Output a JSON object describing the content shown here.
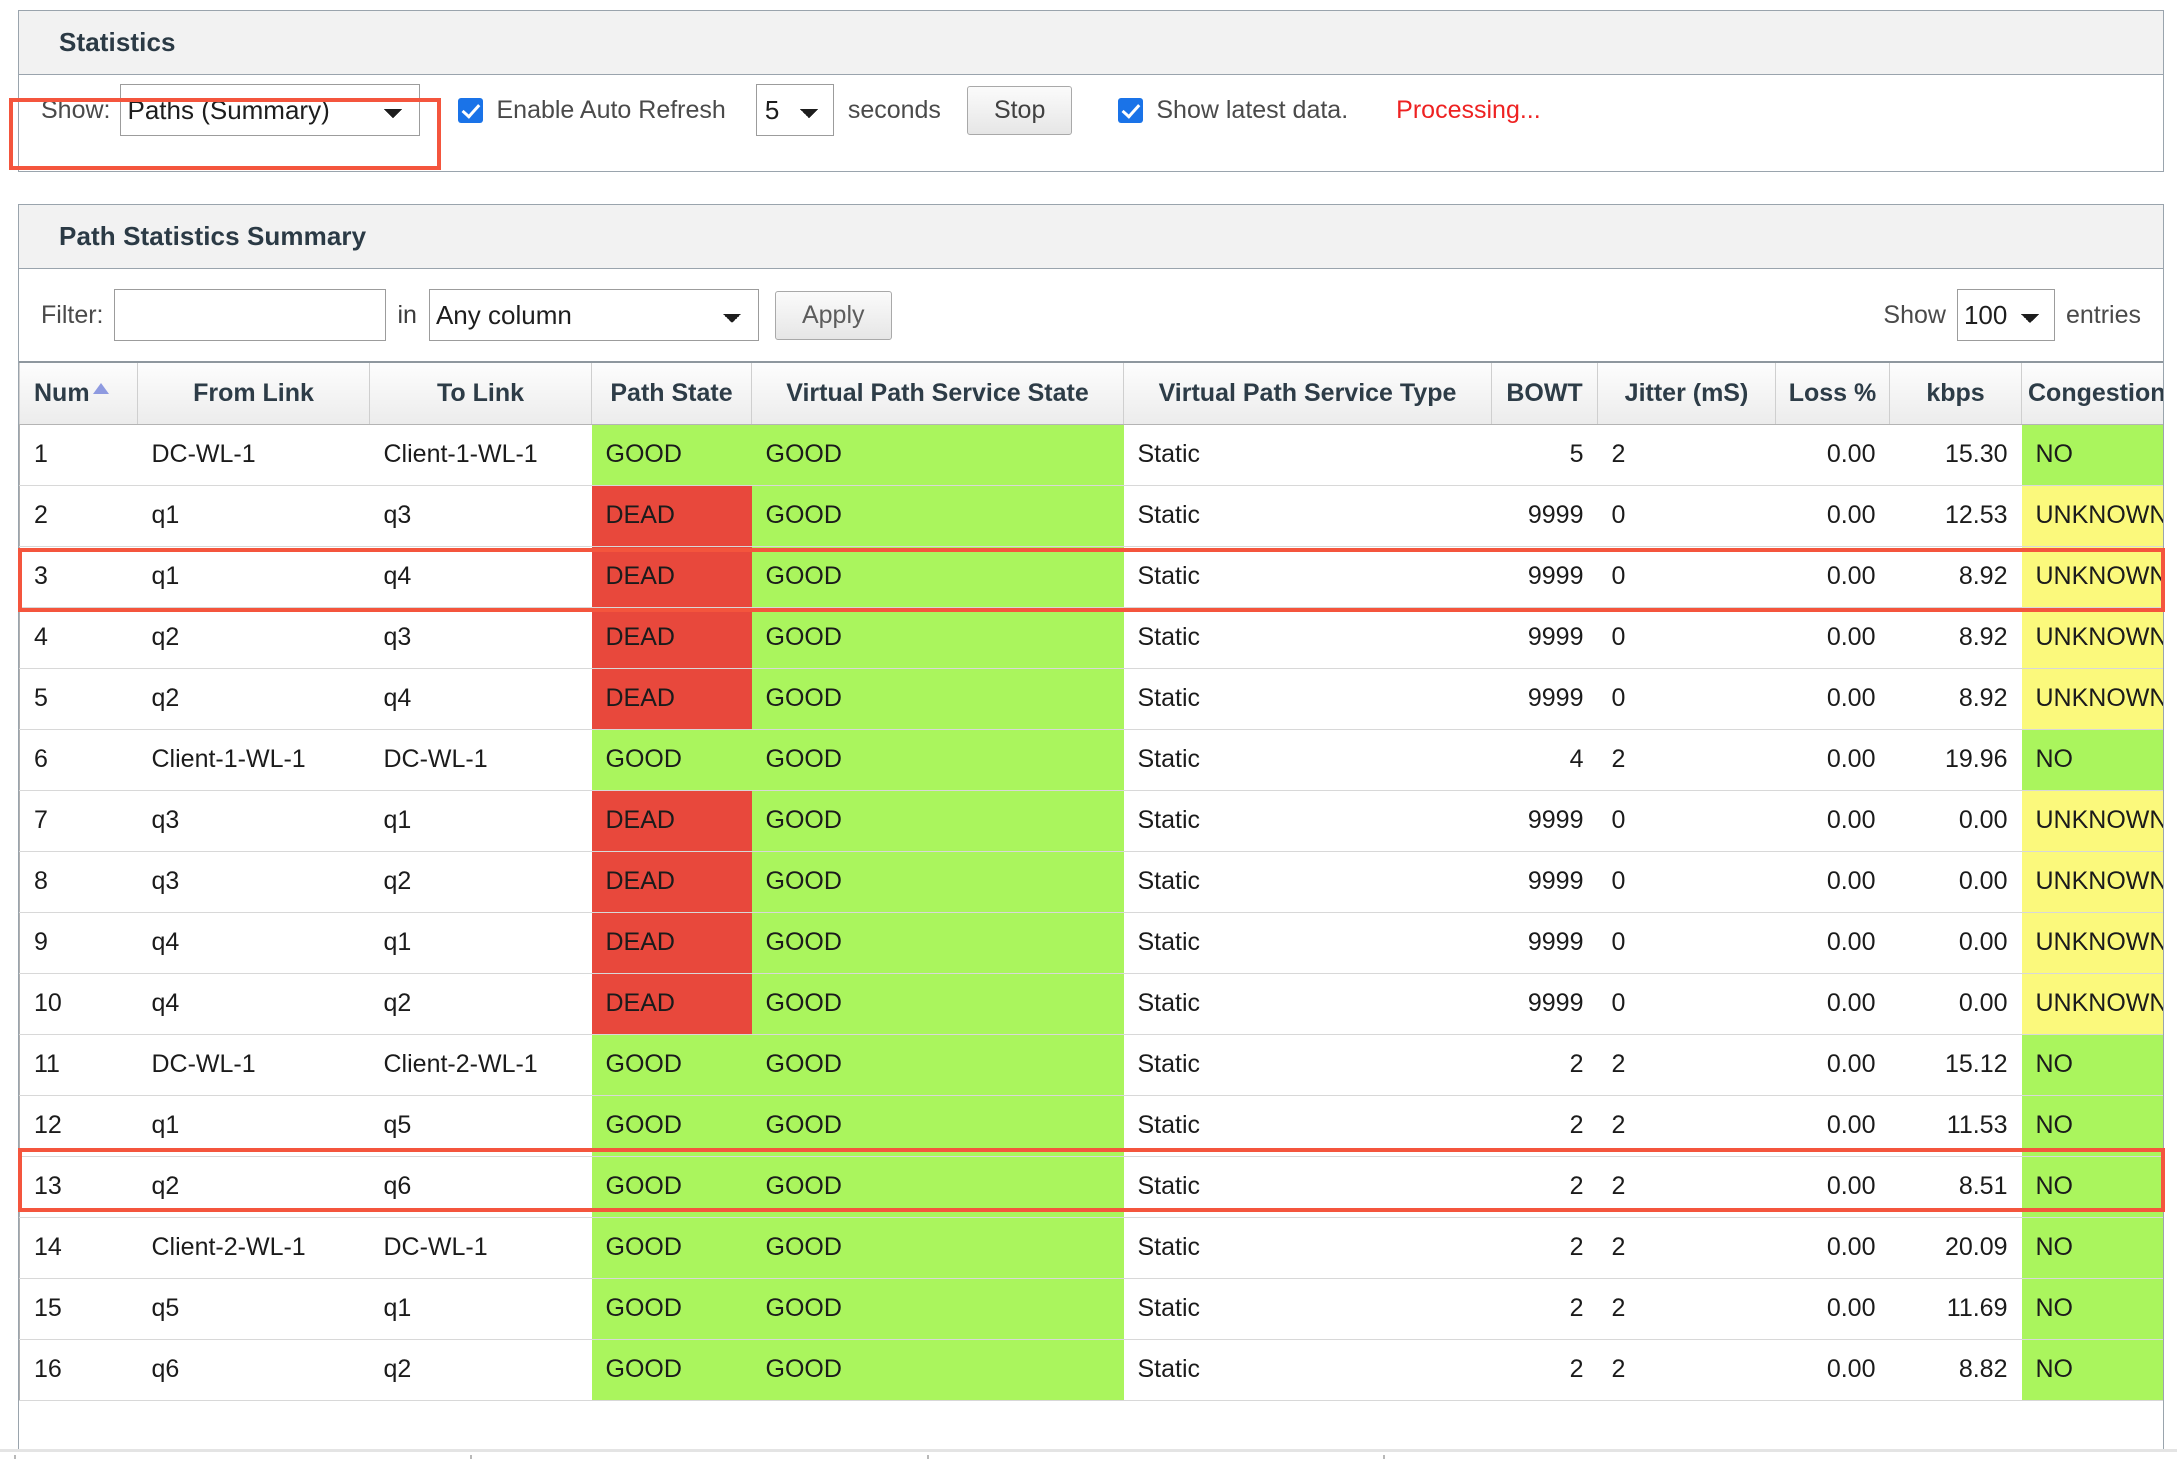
{
  "statistics": {
    "title": "Statistics",
    "show_label": "Show:",
    "show_value": "Paths (Summary)",
    "show_options": [
      "Paths (Summary)"
    ],
    "auto_refresh_label": "Enable Auto Refresh",
    "auto_refresh_checked": true,
    "seconds_value": "5",
    "seconds_options": [
      "5"
    ],
    "seconds_label": "seconds",
    "stop_button": "Stop",
    "latest_data_label": "Show latest data.",
    "latest_data_checked": true,
    "processing_text": "Processing...",
    "processing_color": "#ee2222",
    "highlight_color": "#f4553d"
  },
  "path_panel": {
    "title": "Path Statistics Summary",
    "filter_label": "Filter:",
    "filter_value": "",
    "filter_placeholder": "",
    "in_word": "in",
    "column_select_value": "Any column",
    "column_select_options": [
      "Any column"
    ],
    "apply_button": "Apply",
    "show_word": "Show",
    "entries_value": "100",
    "entries_options": [
      "100"
    ],
    "entries_word": "entries"
  },
  "table": {
    "sort_column": "Num",
    "sort_direction": "asc",
    "headers": [
      "Num",
      "From Link",
      "To Link",
      "Path State",
      "Virtual Path Service State",
      "Virtual Path Service Type",
      "BOWT",
      "Jitter (mS)",
      "Loss %",
      "kbps",
      "Congestion"
    ],
    "colors": {
      "good": "#aaf55d",
      "dead": "#e8483c",
      "unknown": "#fbf97c",
      "no_congestion": "#aaf55d"
    },
    "rows": [
      {
        "num": "1",
        "from": "DC-WL-1",
        "to": "Client-1-WL-1",
        "path_state": "GOOD",
        "vp_service_state": "GOOD",
        "vp_service_type": "Static",
        "bowt": "5",
        "jitter": "2",
        "loss": "0.00",
        "kbps": "15.30",
        "congestion": "NO",
        "highlight": false
      },
      {
        "num": "2",
        "from": "q1",
        "to": "q3",
        "path_state": "DEAD",
        "vp_service_state": "GOOD",
        "vp_service_type": "Static",
        "bowt": "9999",
        "jitter": "0",
        "loss": "0.00",
        "kbps": "12.53",
        "congestion": "UNKNOWN",
        "highlight": true
      },
      {
        "num": "3",
        "from": "q1",
        "to": "q4",
        "path_state": "DEAD",
        "vp_service_state": "GOOD",
        "vp_service_type": "Static",
        "bowt": "9999",
        "jitter": "0",
        "loss": "0.00",
        "kbps": "8.92",
        "congestion": "UNKNOWN",
        "highlight": false
      },
      {
        "num": "4",
        "from": "q2",
        "to": "q3",
        "path_state": "DEAD",
        "vp_service_state": "GOOD",
        "vp_service_type": "Static",
        "bowt": "9999",
        "jitter": "0",
        "loss": "0.00",
        "kbps": "8.92",
        "congestion": "UNKNOWN",
        "highlight": false
      },
      {
        "num": "5",
        "from": "q2",
        "to": "q4",
        "path_state": "DEAD",
        "vp_service_state": "GOOD",
        "vp_service_type": "Static",
        "bowt": "9999",
        "jitter": "0",
        "loss": "0.00",
        "kbps": "8.92",
        "congestion": "UNKNOWN",
        "highlight": false
      },
      {
        "num": "6",
        "from": "Client-1-WL-1",
        "to": "DC-WL-1",
        "path_state": "GOOD",
        "vp_service_state": "GOOD",
        "vp_service_type": "Static",
        "bowt": "4",
        "jitter": "2",
        "loss": "0.00",
        "kbps": "19.96",
        "congestion": "NO",
        "highlight": false
      },
      {
        "num": "7",
        "from": "q3",
        "to": "q1",
        "path_state": "DEAD",
        "vp_service_state": "GOOD",
        "vp_service_type": "Static",
        "bowt": "9999",
        "jitter": "0",
        "loss": "0.00",
        "kbps": "0.00",
        "congestion": "UNKNOWN",
        "highlight": false
      },
      {
        "num": "8",
        "from": "q3",
        "to": "q2",
        "path_state": "DEAD",
        "vp_service_state": "GOOD",
        "vp_service_type": "Static",
        "bowt": "9999",
        "jitter": "0",
        "loss": "0.00",
        "kbps": "0.00",
        "congestion": "UNKNOWN",
        "highlight": false
      },
      {
        "num": "9",
        "from": "q4",
        "to": "q1",
        "path_state": "DEAD",
        "vp_service_state": "GOOD",
        "vp_service_type": "Static",
        "bowt": "9999",
        "jitter": "0",
        "loss": "0.00",
        "kbps": "0.00",
        "congestion": "UNKNOWN",
        "highlight": false
      },
      {
        "num": "10",
        "from": "q4",
        "to": "q2",
        "path_state": "DEAD",
        "vp_service_state": "GOOD",
        "vp_service_type": "Static",
        "bowt": "9999",
        "jitter": "0",
        "loss": "0.00",
        "kbps": "0.00",
        "congestion": "UNKNOWN",
        "highlight": false
      },
      {
        "num": "11",
        "from": "DC-WL-1",
        "to": "Client-2-WL-1",
        "path_state": "GOOD",
        "vp_service_state": "GOOD",
        "vp_service_type": "Static",
        "bowt": "2",
        "jitter": "2",
        "loss": "0.00",
        "kbps": "15.12",
        "congestion": "NO",
        "highlight": false
      },
      {
        "num": "12",
        "from": "q1",
        "to": "q5",
        "path_state": "GOOD",
        "vp_service_state": "GOOD",
        "vp_service_type": "Static",
        "bowt": "2",
        "jitter": "2",
        "loss": "0.00",
        "kbps": "11.53",
        "congestion": "NO",
        "highlight": true
      },
      {
        "num": "13",
        "from": "q2",
        "to": "q6",
        "path_state": "GOOD",
        "vp_service_state": "GOOD",
        "vp_service_type": "Static",
        "bowt": "2",
        "jitter": "2",
        "loss": "0.00",
        "kbps": "8.51",
        "congestion": "NO",
        "highlight": false
      },
      {
        "num": "14",
        "from": "Client-2-WL-1",
        "to": "DC-WL-1",
        "path_state": "GOOD",
        "vp_service_state": "GOOD",
        "vp_service_type": "Static",
        "bowt": "2",
        "jitter": "2",
        "loss": "0.00",
        "kbps": "20.09",
        "congestion": "NO",
        "highlight": false
      },
      {
        "num": "15",
        "from": "q5",
        "to": "q1",
        "path_state": "GOOD",
        "vp_service_state": "GOOD",
        "vp_service_type": "Static",
        "bowt": "2",
        "jitter": "2",
        "loss": "0.00",
        "kbps": "11.69",
        "congestion": "NO",
        "highlight": false
      },
      {
        "num": "16",
        "from": "q6",
        "to": "q2",
        "path_state": "GOOD",
        "vp_service_state": "GOOD",
        "vp_service_type": "Static",
        "bowt": "2",
        "jitter": "2",
        "loss": "0.00",
        "kbps": "8.82",
        "congestion": "NO",
        "highlight": false
      }
    ]
  }
}
